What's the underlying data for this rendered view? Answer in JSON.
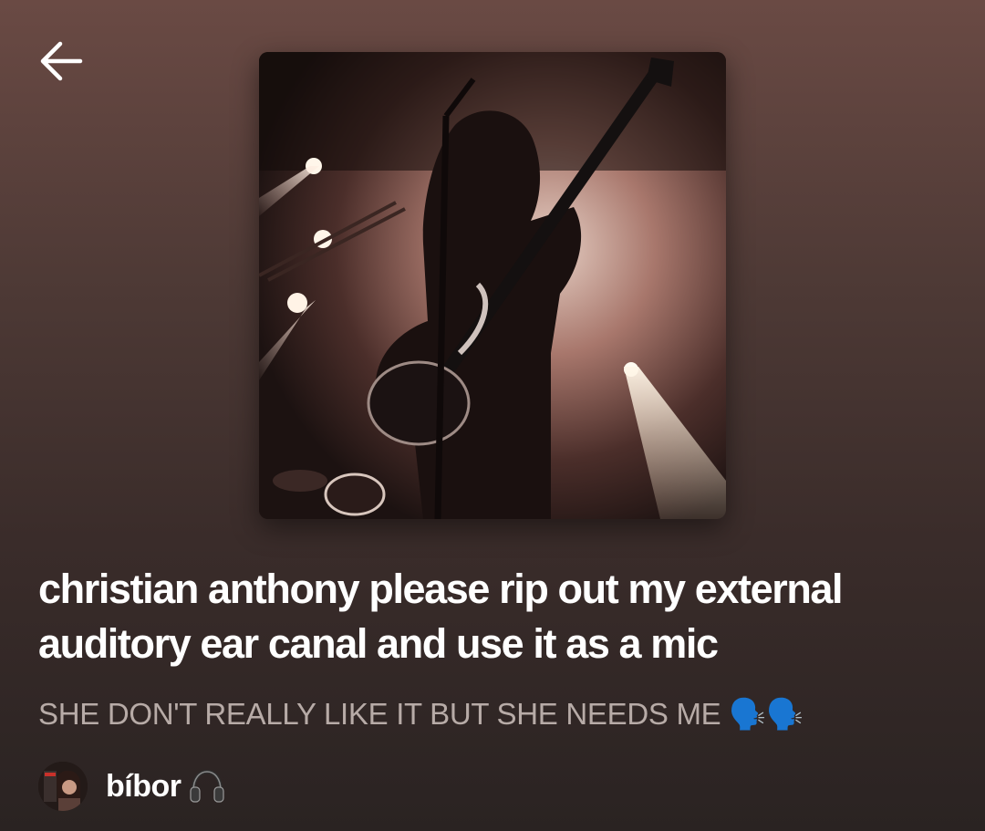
{
  "header": {
    "back_icon": "arrow-left-icon"
  },
  "playlist": {
    "cover_description": "concert-stage-guitarist-cover-icon",
    "title": "christian anthony please rip out my external auditory ear canal and use it as a mic",
    "description": "SHE DON'T REALLY LIKE IT BUT SHE NEEDS ME 🗣️🗣️",
    "owner": {
      "name": "bíbor",
      "emoji_icon": "headphones-icon",
      "avatar_icon": "profile-avatar-icon"
    }
  },
  "colors": {
    "background_top": "#6a4a44",
    "background_bottom": "#2a2322",
    "title": "#ffffff",
    "description": "#b7aba7"
  }
}
